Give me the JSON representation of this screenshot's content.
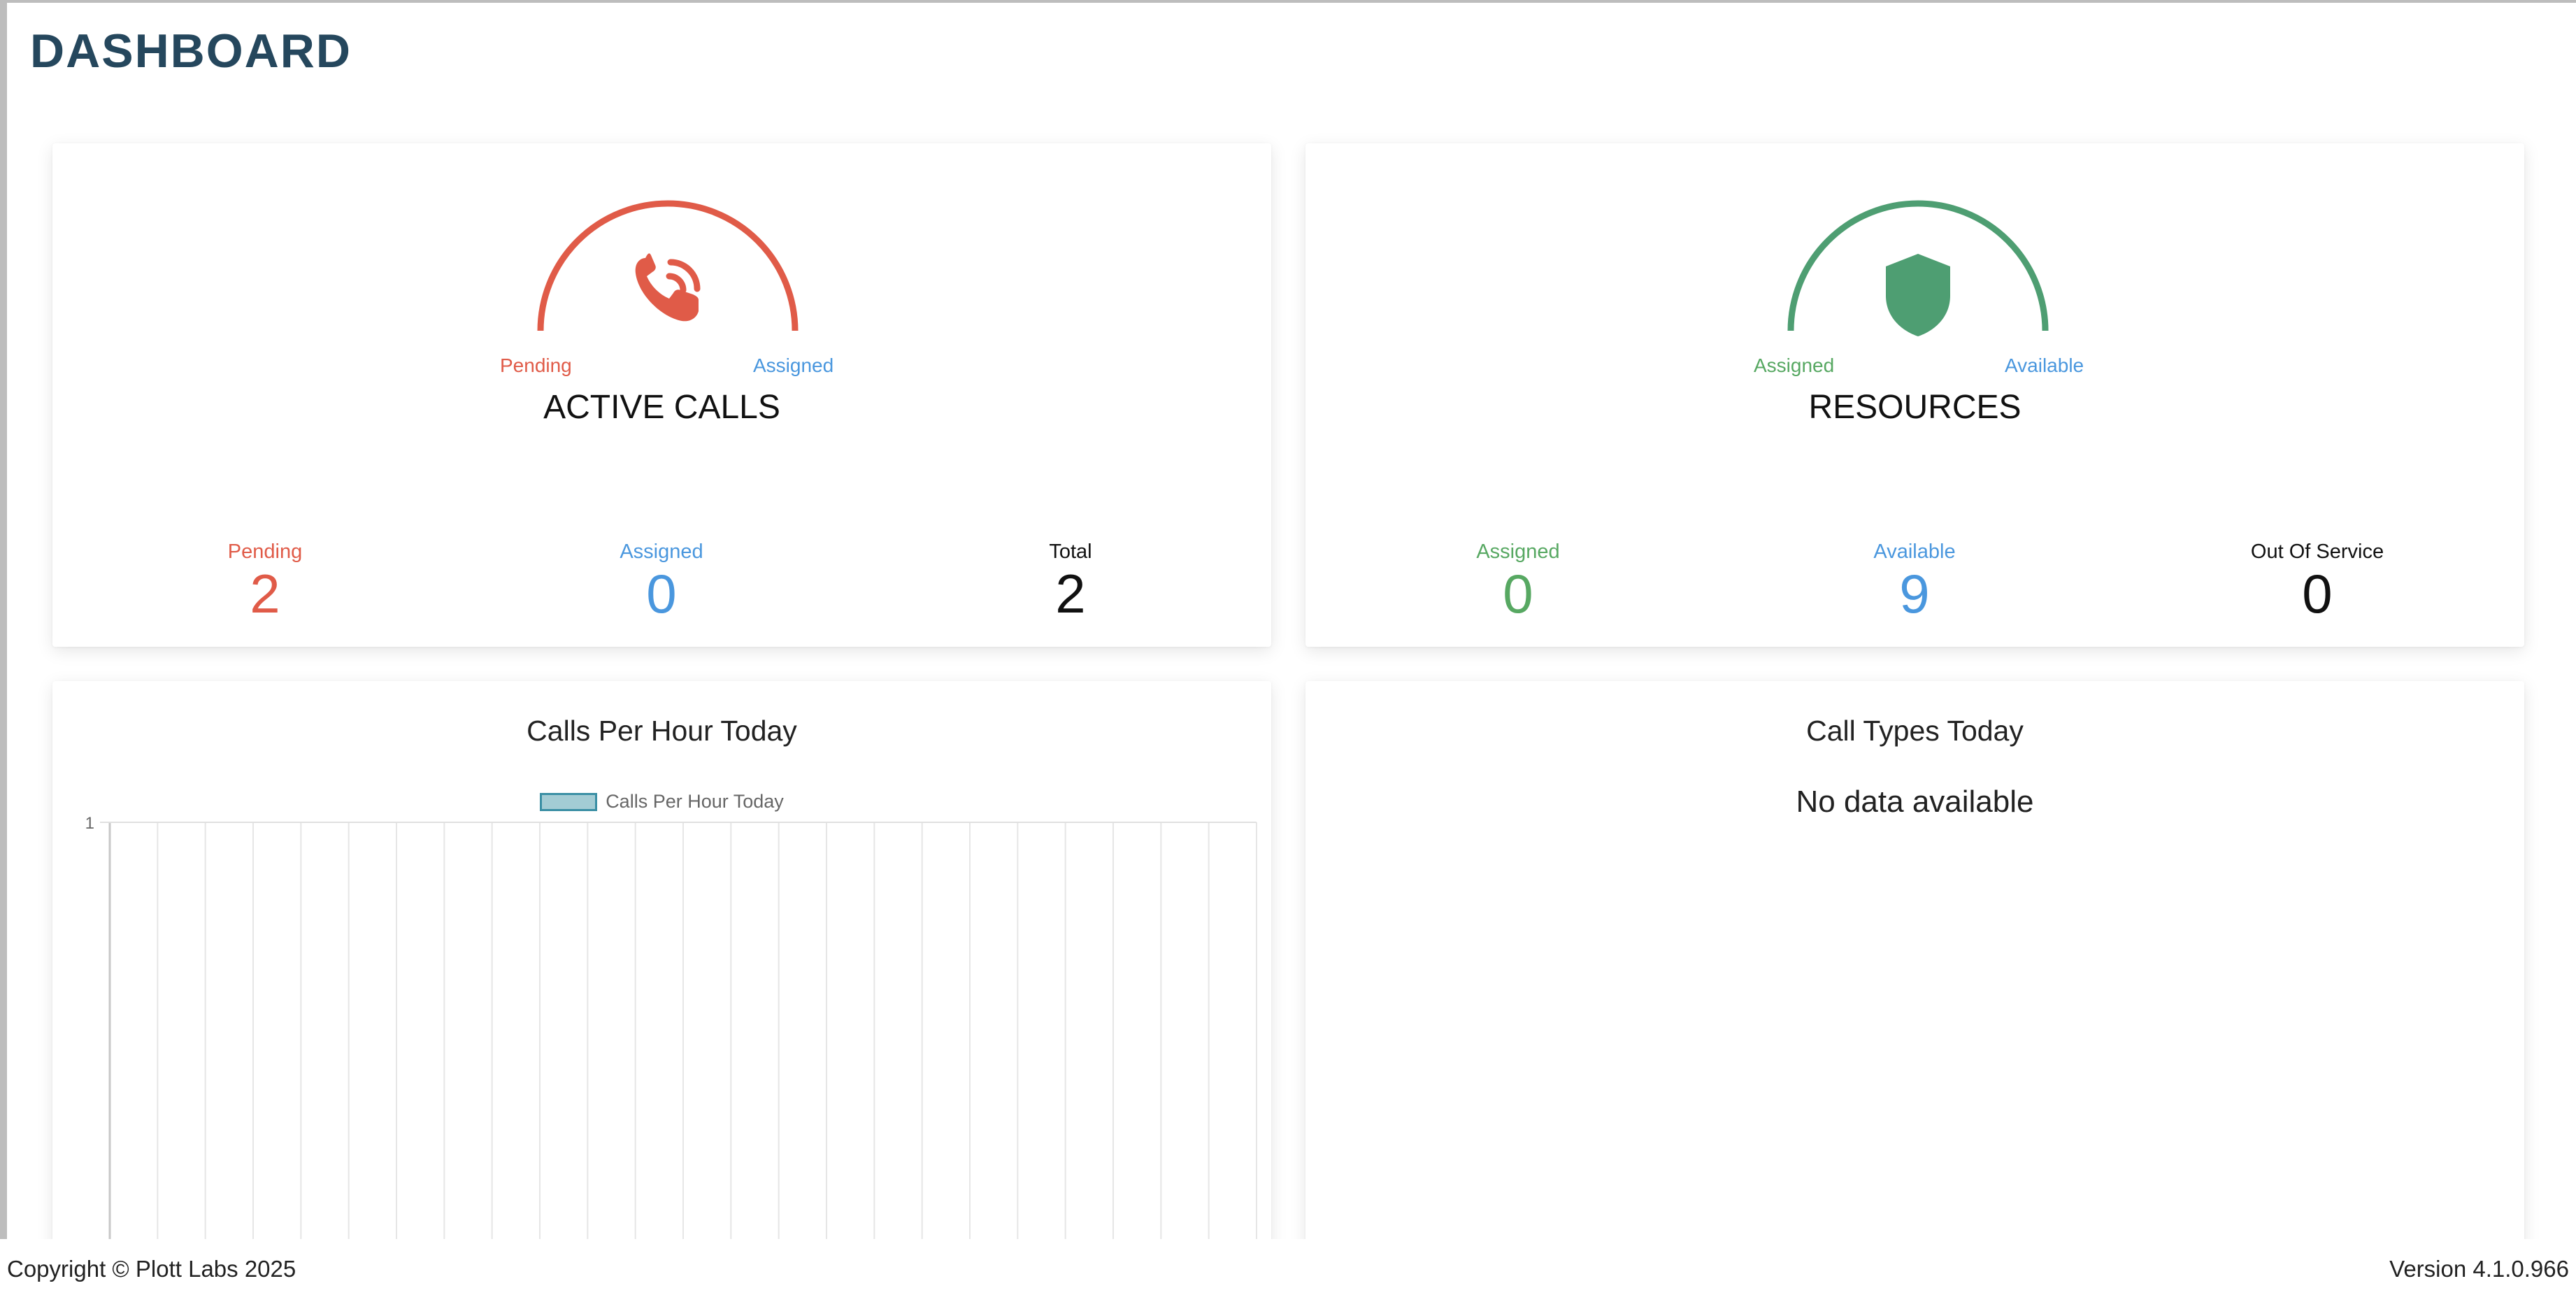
{
  "page": {
    "title": "DASHBOARD"
  },
  "active_calls": {
    "heading": "ACTIVE CALLS",
    "gauge_left_label": "Pending",
    "gauge_right_label": "Assigned",
    "icon": "phone-ringing-icon",
    "color": "#e05b48",
    "stats": [
      {
        "label": "Pending",
        "value": "2",
        "color": "#e05b48"
      },
      {
        "label": "Assigned",
        "value": "0",
        "color": "#4a97de"
      },
      {
        "label": "Total",
        "value": "2",
        "color": "#111111"
      }
    ]
  },
  "resources": {
    "heading": "RESOURCES",
    "gauge_left_label": "Assigned",
    "gauge_right_label": "Available",
    "icon": "shield-icon",
    "color": "#4e9e72",
    "stats": [
      {
        "label": "Assigned",
        "value": "0",
        "color": "#57a862"
      },
      {
        "label": "Available",
        "value": "9",
        "color": "#4a97de"
      },
      {
        "label": "Out Of Service",
        "value": "0",
        "color": "#111111"
      }
    ]
  },
  "calls_per_hour": {
    "title": "Calls Per Hour Today",
    "chart_data": {
      "type": "bar",
      "title": "Calls Per Hour Today",
      "legend": "top",
      "series": [
        {
          "name": "Calls Per Hour Today",
          "values": []
        }
      ],
      "y_tick_labels": [
        "1"
      ],
      "ylim": [
        0,
        1
      ],
      "grid": true,
      "bar_color": "#a3ccd4",
      "bar_border_color": "#3a8fa4"
    }
  },
  "call_types": {
    "title": "Call Types Today",
    "message": "No data available"
  },
  "footer": {
    "copyright": "Copyright © Plott Labs 2025",
    "version": "Version 4.1.0.966"
  }
}
